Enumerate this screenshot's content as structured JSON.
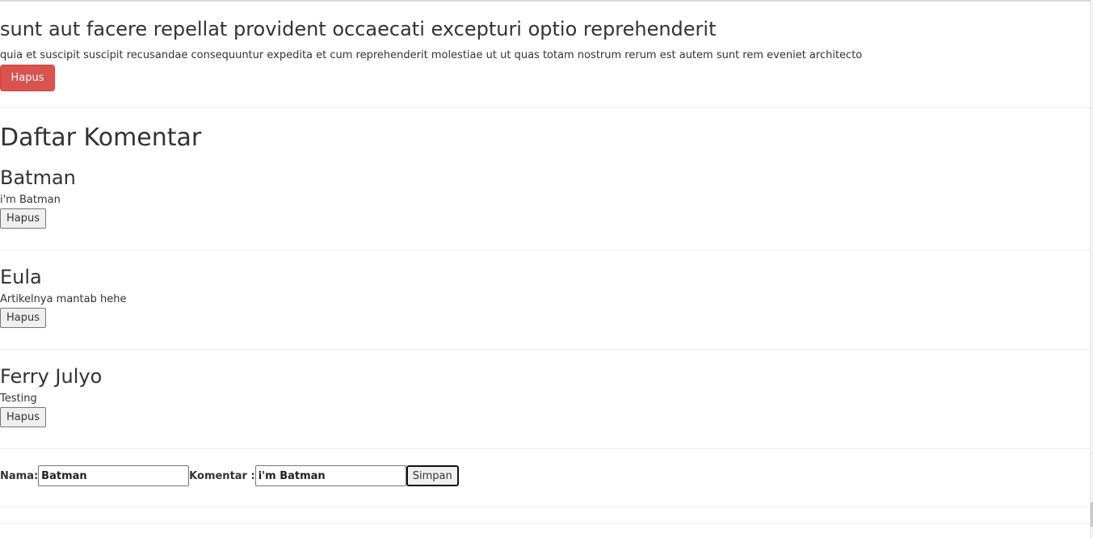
{
  "article": {
    "title": "sunt aut facere repellat provident occaecati excepturi optio reprehenderit",
    "body": "quia et suscipit suscipit recusandae consequuntur expedita et cum reprehenderit molestiae ut ut quas totam nostrum rerum est autem sunt rem eveniet architecto",
    "delete_label": "Hapus"
  },
  "comments_section": {
    "heading": "Daftar Komentar",
    "items": [
      {
        "name": "Batman",
        "text": "i'm Batman",
        "delete_label": "Hapus"
      },
      {
        "name": "Eula",
        "text": "Artikelnya mantab hehe",
        "delete_label": "Hapus"
      },
      {
        "name": "Ferry Julyo",
        "text": "Testing",
        "delete_label": "Hapus"
      }
    ]
  },
  "form": {
    "name_label": "Nama:",
    "name_value": "Batman",
    "comment_label": "Komentar :",
    "comment_value": "i'm Batman",
    "submit_label": "Simpan"
  },
  "colors": {
    "danger": "#d9534f",
    "text": "#333333",
    "divider": "#eeeeee"
  }
}
